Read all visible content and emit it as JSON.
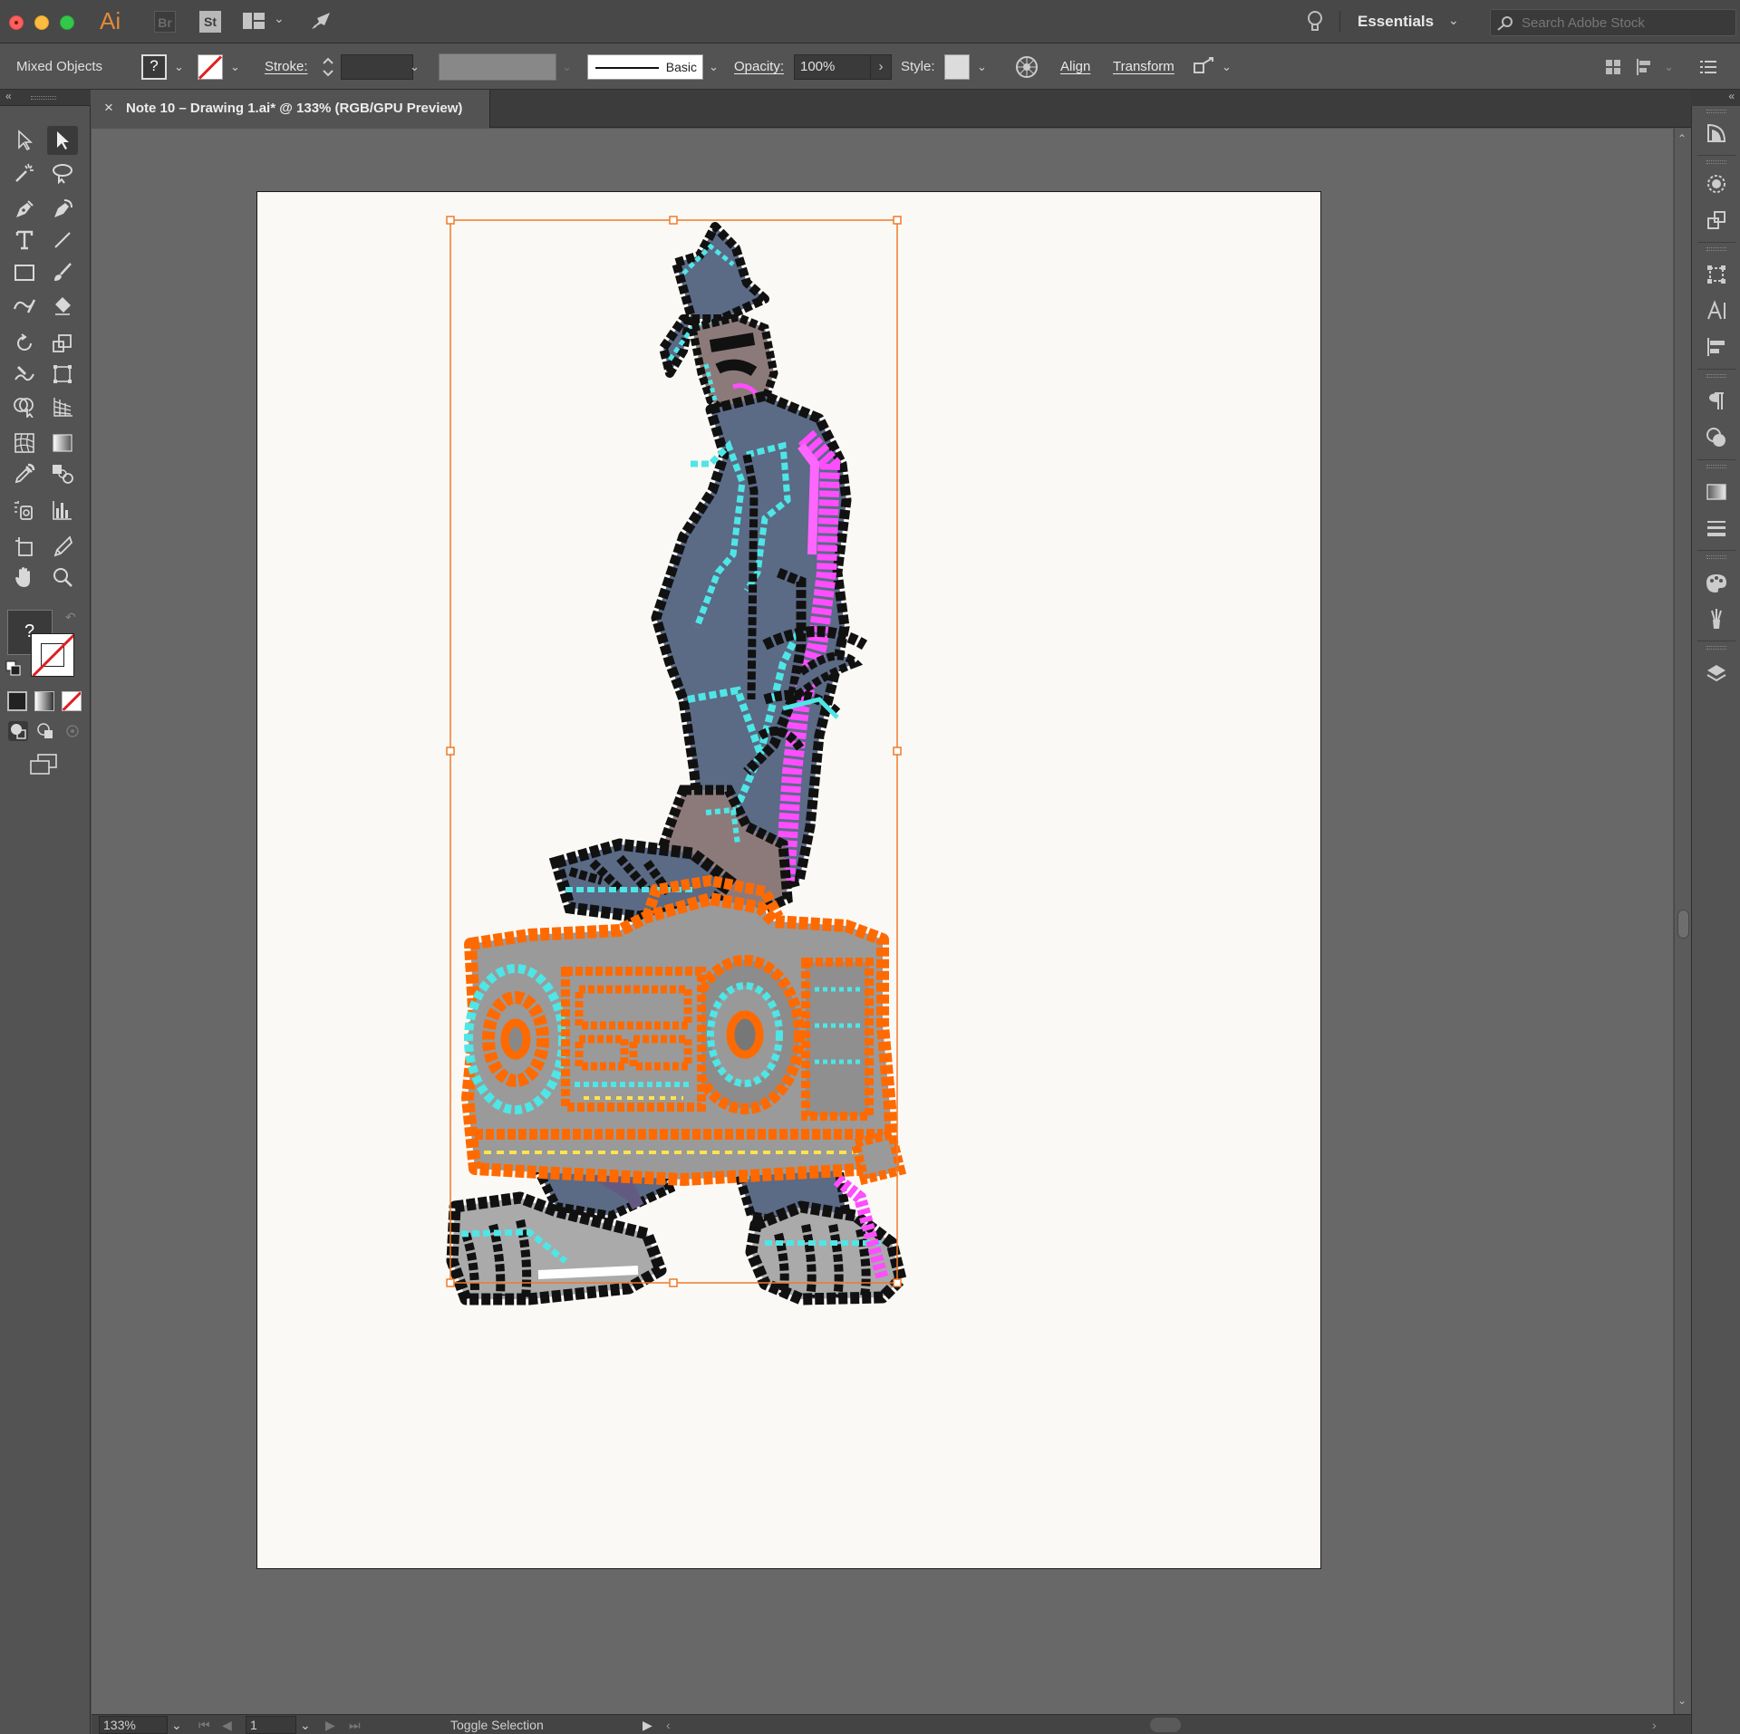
{
  "app": {
    "logo": "Ai",
    "bridge": "Br",
    "stock": "St",
    "workspace": "Essentials",
    "search_placeholder": "Search Adobe Stock"
  },
  "control": {
    "selection_type": "Mixed Objects",
    "fill_swatch": "?",
    "stroke_label": "Stroke:",
    "brush_label": "Basic",
    "opacity_label": "Opacity:",
    "opacity_value": "100%",
    "style_label": "Style:",
    "align_label": "Align",
    "transform_label": "Transform"
  },
  "document": {
    "tab_title": "Note 10 – Drawing 1.ai* @ 133% (RGB/GPU Preview)"
  },
  "toolbar": {
    "fill_indicator": "?"
  },
  "status": {
    "zoom": "133%",
    "page": "1",
    "info": "Toggle Selection"
  },
  "colors": {
    "selection": "#f07a2a",
    "artboard": "#faf9f5",
    "canvas": "#686868",
    "panel": "#535353"
  },
  "icons": {
    "tools": [
      "selection-tool",
      "direct-selection-tool",
      "magic-wand-tool",
      "lasso-tool",
      "pen-tool",
      "curvature-tool",
      "type-tool",
      "line-segment-tool",
      "rectangle-tool",
      "paintbrush-tool",
      "shaper-tool",
      "eraser-tool",
      "rotate-tool",
      "scale-tool",
      "warp-tool",
      "free-transform-tool",
      "shape-builder-tool",
      "perspective-grid-tool",
      "mesh-tool",
      "gradient-tool",
      "eyedropper-tool",
      "blend-tool",
      "symbol-sprayer-tool",
      "column-graph-tool",
      "artboard-tool",
      "slice-tool",
      "hand-tool",
      "zoom-tool"
    ],
    "dock": [
      "properties-icon",
      "appearance-icon",
      "libraries-icon",
      "transform-icon",
      "character-icon",
      "align-icon",
      "paragraph-icon",
      "color-icon",
      "gradient-icon",
      "stroke-icon",
      "swatches-icon",
      "brushes-icon",
      "layers-icon"
    ]
  }
}
